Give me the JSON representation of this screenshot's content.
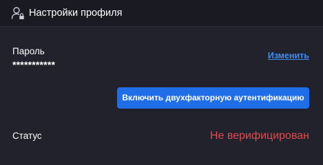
{
  "header": {
    "title": "Настройки профиля",
    "icon": "user-lock-icon"
  },
  "password": {
    "label": "Пароль",
    "value": "***********",
    "change_link": "Изменить"
  },
  "two_factor": {
    "button_label": "Включить двухфакторную аутентификацию"
  },
  "status": {
    "label": "Статус",
    "value": "Не верифицирован"
  },
  "colors": {
    "background": "#21222c",
    "header_background": "#1a1b22",
    "link": "#3f8cf2",
    "button": "#1f6ee8",
    "status_error": "#e5484d"
  }
}
